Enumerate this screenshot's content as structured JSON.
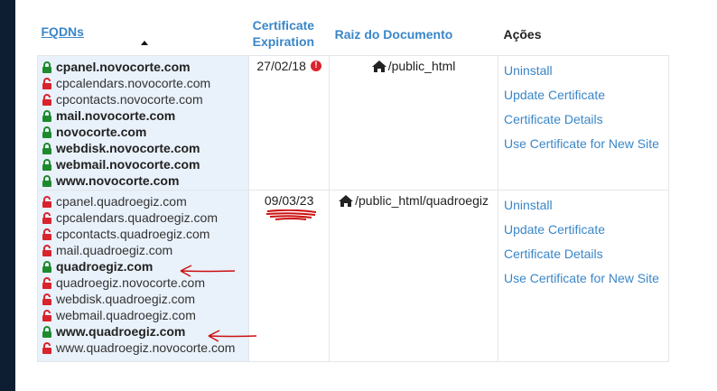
{
  "headers": {
    "fqdns": "FQDNs",
    "cert_line1": "Certificate",
    "cert_line2": "Expiration",
    "docroot": "Raiz do Documento",
    "actions": "Ações"
  },
  "colors": {
    "link": "#3a86c8",
    "secure_lock": "#1e8a2e",
    "insecure_lock": "#d9232d",
    "alert": "#d9232d",
    "annotation": "#cc1111"
  },
  "rows": [
    {
      "fqdns": [
        {
          "name": "cpanel.novocorte.com",
          "secure": true
        },
        {
          "name": "cpcalendars.novocorte.com",
          "secure": false
        },
        {
          "name": "cpcontacts.novocorte.com",
          "secure": false
        },
        {
          "name": "mail.novocorte.com",
          "secure": true
        },
        {
          "name": "novocorte.com",
          "secure": true
        },
        {
          "name": "webdisk.novocorte.com",
          "secure": true
        },
        {
          "name": "webmail.novocorte.com",
          "secure": true
        },
        {
          "name": "www.novocorte.com",
          "secure": true
        }
      ],
      "expiration": "27/02/18",
      "expiration_alert": "!",
      "docroot": "/public_html",
      "actions": [
        "Uninstall",
        "Update Certificate",
        "Certificate Details",
        "Use Certificate for New Site"
      ]
    },
    {
      "fqdns": [
        {
          "name": "cpanel.quadroegiz.com",
          "secure": false
        },
        {
          "name": "cpcalendars.quadroegiz.com",
          "secure": false
        },
        {
          "name": "cpcontacts.quadroegiz.com",
          "secure": false
        },
        {
          "name": "mail.quadroegiz.com",
          "secure": false
        },
        {
          "name": "quadroegiz.com",
          "secure": true
        },
        {
          "name": "quadroegiz.novocorte.com",
          "secure": false
        },
        {
          "name": "webdisk.quadroegiz.com",
          "secure": false
        },
        {
          "name": "webmail.quadroegiz.com",
          "secure": false
        },
        {
          "name": "www.quadroegiz.com",
          "secure": true
        },
        {
          "name": "www.quadroegiz.novocorte.com",
          "secure": false
        }
      ],
      "expiration": "09/03/23",
      "docroot": "/public_html/quadroegiz",
      "actions": [
        "Uninstall",
        "Update Certificate",
        "Certificate Details",
        "Use Certificate for New Site"
      ]
    }
  ]
}
